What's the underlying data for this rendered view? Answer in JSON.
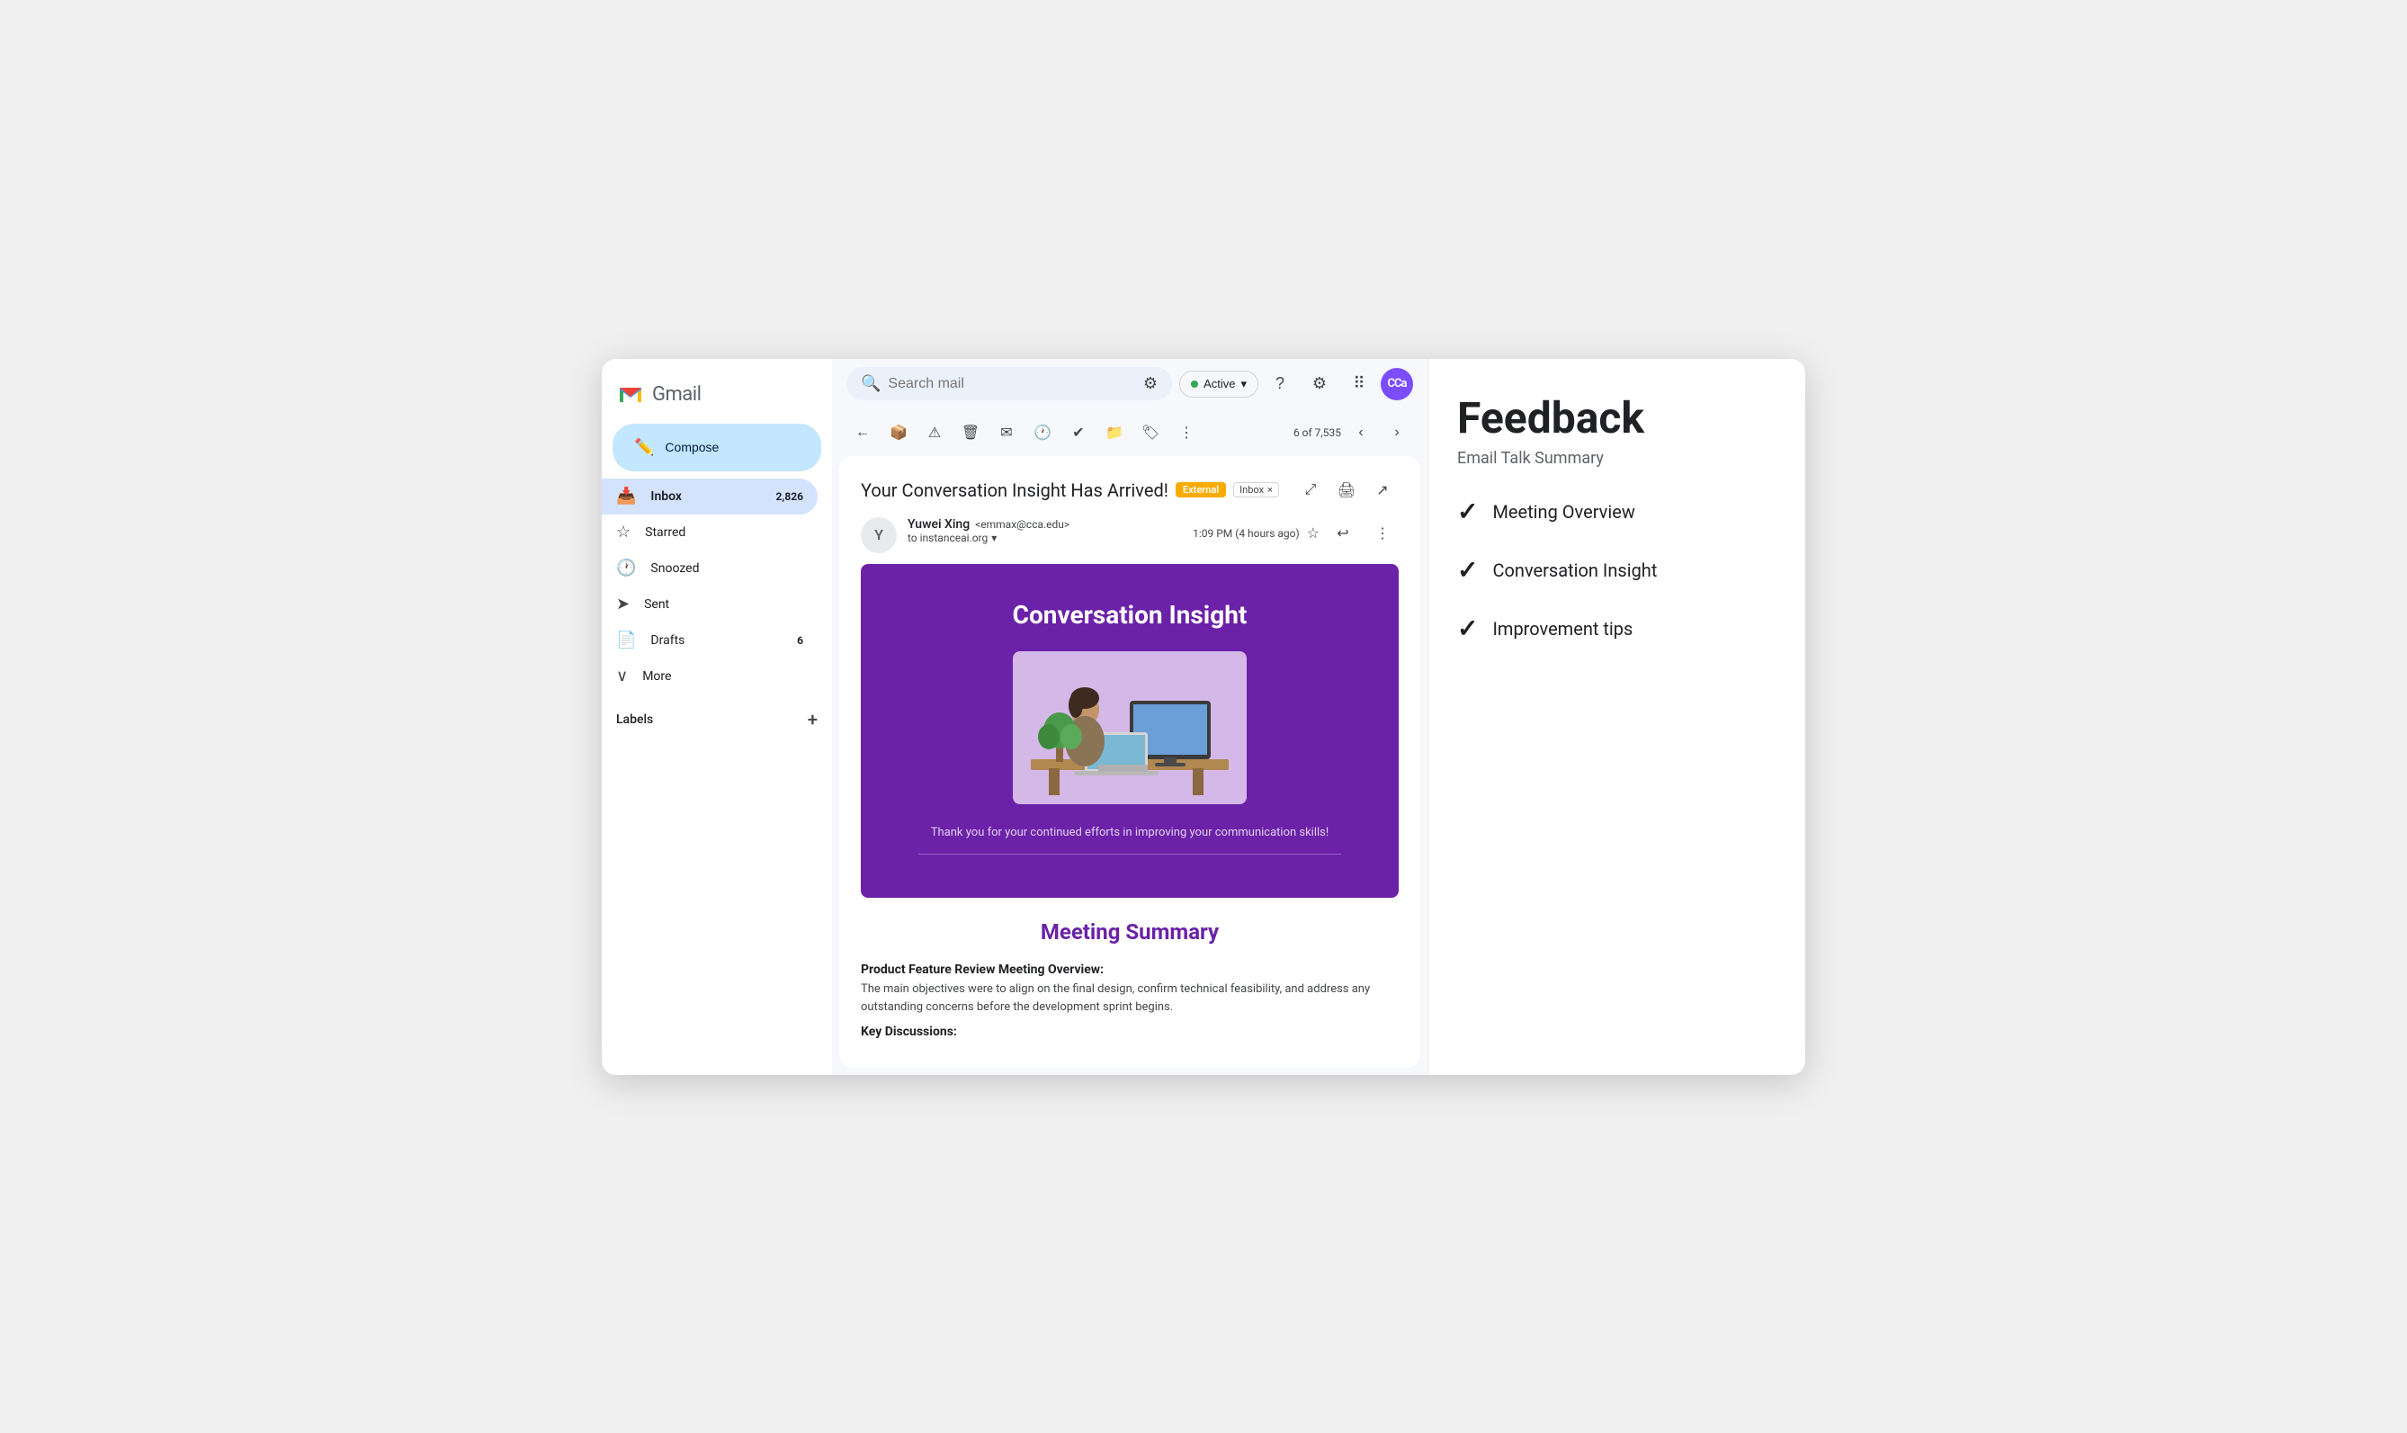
{
  "window": {
    "title": "Gmail"
  },
  "sidebar": {
    "logo_text": "Gmail",
    "compose_label": "Compose",
    "nav_items": [
      {
        "id": "inbox",
        "label": "Inbox",
        "badge": "2,826",
        "active": true,
        "icon": "📥"
      },
      {
        "id": "starred",
        "label": "Starred",
        "badge": "",
        "active": false,
        "icon": "☆"
      },
      {
        "id": "snoozed",
        "label": "Snoozed",
        "badge": "",
        "active": false,
        "icon": "🕐"
      },
      {
        "id": "sent",
        "label": "Sent",
        "badge": "",
        "active": false,
        "icon": "➤"
      },
      {
        "id": "drafts",
        "label": "Drafts",
        "badge": "6",
        "active": false,
        "icon": "📄"
      },
      {
        "id": "more",
        "label": "More",
        "badge": "",
        "active": false,
        "icon": "∨"
      }
    ],
    "labels_section": "Labels",
    "labels_add": "+"
  },
  "top_bar": {
    "search_placeholder": "Search mail",
    "status_label": "Active",
    "avatar_text": "CCa"
  },
  "email_toolbar": {
    "counter": "6 of 7,535"
  },
  "email": {
    "subject": "Your Conversation Insight Has Arrived!",
    "tag_external": "External",
    "tag_inbox": "Inbox",
    "sender_name": "Yuwei Xing",
    "sender_email": "<emmax@cca.edu>",
    "sender_to": "to instanceai.org",
    "time": "1:09 PM (4 hours ago)",
    "banner_title": "Conversation Insight",
    "banner_subtitle": "Thank you for your continued efforts in improving your communication skills!",
    "meeting_summary_title": "Meeting Summary",
    "meeting_overview_label": "Product Feature Review Meeting Overview:",
    "meeting_overview_text": "The main objectives were to align on the final design, confirm technical feasibility, and address any outstanding concerns before the development sprint begins.",
    "key_discussions_label": "Key Discussions:"
  },
  "feedback_panel": {
    "title": "Feedback",
    "subtitle": "Email Talk Summary",
    "items": [
      {
        "id": "meeting-overview",
        "label": "Meeting Overview"
      },
      {
        "id": "conversation-insight",
        "label": "Conversation Insight"
      },
      {
        "id": "improvement-tips",
        "label": "Improvement tips"
      }
    ]
  }
}
